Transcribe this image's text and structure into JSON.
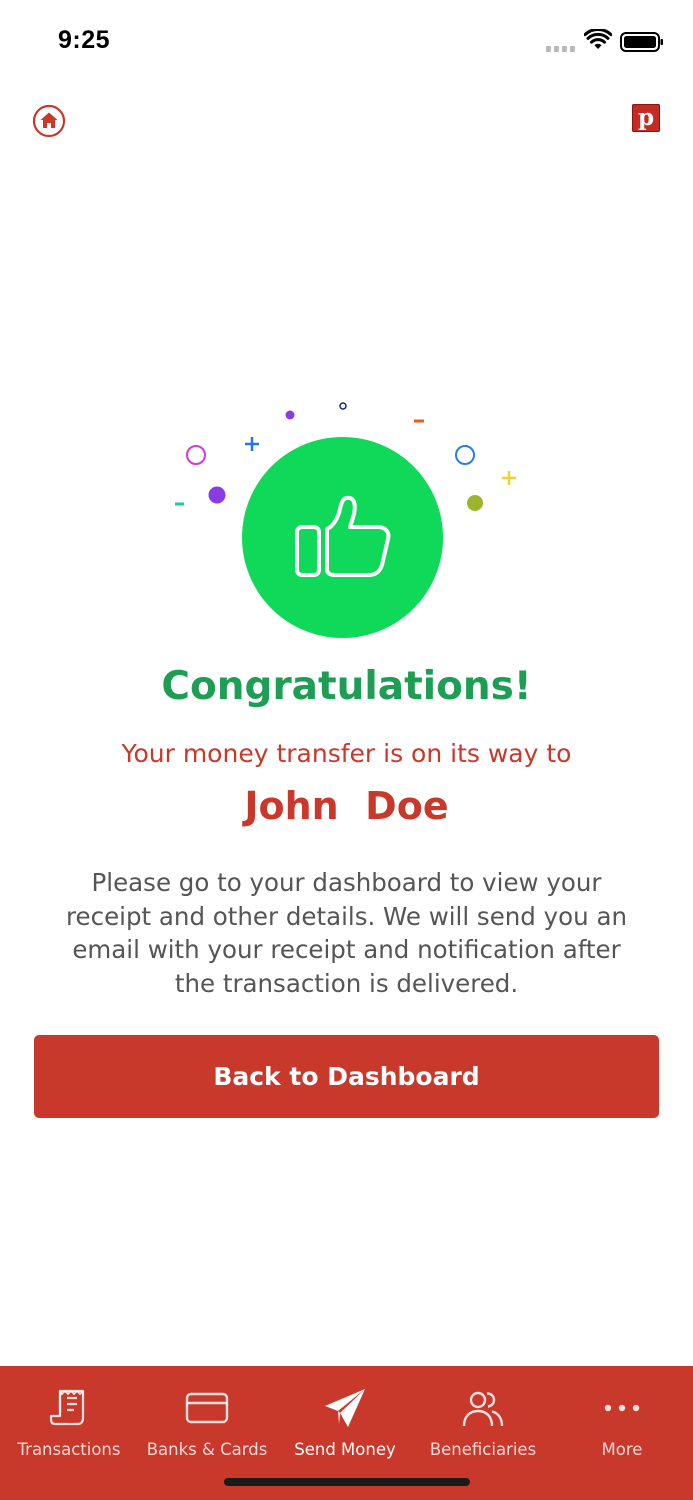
{
  "status_bar": {
    "time": "9:25"
  },
  "header": {
    "home_icon": "home-icon",
    "profile_logo_letter": "p"
  },
  "confirmation": {
    "icon": "thumbs-up-icon",
    "title": "Congratulations!",
    "subtitle": "Your money transfer is on its way to",
    "recipient_name": "John  Doe",
    "message": "Please go to your dashboard to view your receipt and other details. We will send you an email with your receipt and notification after the transaction is delivered.",
    "button_label": "Back to Dashboard"
  },
  "tab_bar": {
    "active": "Send Money",
    "items": [
      {
        "label": "Transactions",
        "icon": "receipt-icon"
      },
      {
        "label": "Banks & Cards",
        "icon": "card-icon"
      },
      {
        "label": "Send Money",
        "icon": "paper-plane-icon"
      },
      {
        "label": "Beneficiaries",
        "icon": "users-icon"
      },
      {
        "label": "More",
        "icon": "more-dots-icon"
      }
    ]
  },
  "colors": {
    "primary": "#c8382b",
    "success_green": "#10d858",
    "title_green": "#1e9e55",
    "body_text": "#555555"
  }
}
